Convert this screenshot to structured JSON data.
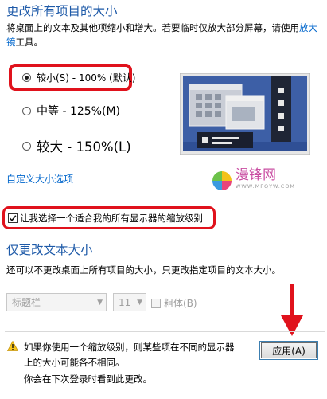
{
  "section_resize": {
    "title": "更改所有项目的大小",
    "description_before_link": "将桌面上的文本及其他项缩小和增大。若要临时仅放大部分屏幕，请使用",
    "magnifier_link": "放大镜",
    "description_after_link": "工具。",
    "options": [
      {
        "label": "较小(S) - 100% (默认)",
        "selected": true
      },
      {
        "label": "中等 - 125%(M)",
        "selected": false
      },
      {
        "label": "较大 - 150%(L)",
        "selected": false
      }
    ],
    "custom_size_link": "自定义大小选项"
  },
  "watermark": {
    "text": "漫锋网",
    "subtext": "WWW.MFQYW.COM"
  },
  "scaling_checkbox": {
    "label": "让我选择一个适合我的所有显示器的缩放级别",
    "checked": true
  },
  "section_text": {
    "title": "仅更改文本大小",
    "description": "还可以不更改桌面上所有项目的大小，只更改指定项目的文本大小。",
    "item_select": {
      "value": "标题栏"
    },
    "size_select": {
      "value": "11"
    },
    "bold_label": "粗体(B)"
  },
  "footer": {
    "warning_text": "如果你使用一个缩放级别，则某些项在不同的显示器上的大小可能各不相同。",
    "apply_button": "应用(A)",
    "signout_note": "你会在下次登录时看到此更改。"
  },
  "colors": {
    "heading": "#1e5aa8",
    "link": "#0066cc",
    "highlight": "#e0121c",
    "preview_blue": "#3d5fa6"
  },
  "icons": [
    "warning-icon",
    "checkmark-icon",
    "chevron-down-icon",
    "radio-selected-icon",
    "arrow-down-icon"
  ]
}
